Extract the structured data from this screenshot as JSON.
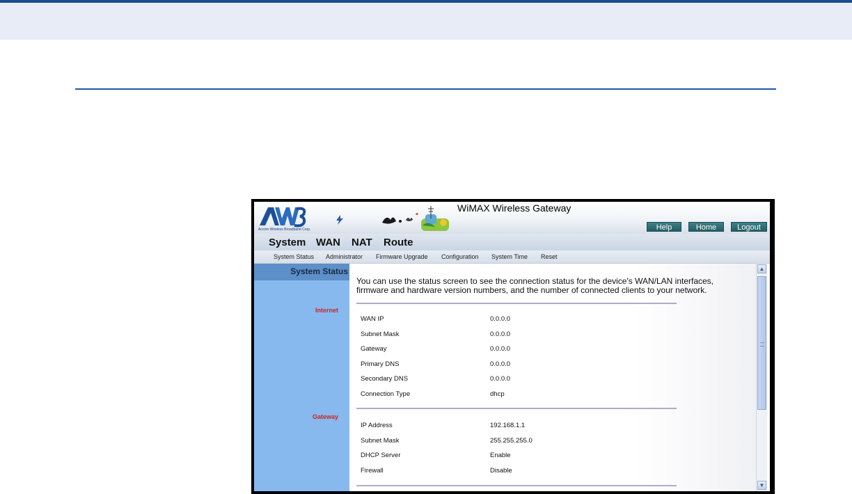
{
  "header": {
    "logo_text": "AW3",
    "logo_subtitle": "Accton Wireless Broadband Corp.",
    "title": "WiMAX Wireless Gateway",
    "buttons": [
      {
        "label": "Help"
      },
      {
        "label": "Home"
      },
      {
        "label": "Logout"
      }
    ]
  },
  "menu": {
    "items": [
      "System",
      "WAN",
      "NAT",
      "Route"
    ]
  },
  "submenu": {
    "items": [
      "System Status",
      "Administrator",
      "Firmware Upgrade",
      "Configuration",
      "System Time",
      "Reset"
    ]
  },
  "sidebar": {
    "heading": "System Status",
    "sections": [
      "Internet",
      "Gateway"
    ]
  },
  "content": {
    "intro": "You can use the status screen to see the connection status for the device's WAN/LAN interfaces, firmware and hardware version numbers, and the number of connected clients to your network.",
    "internet_rows": [
      {
        "label": "WAN IP",
        "value": "0.0.0.0"
      },
      {
        "label": "Subnet Mask",
        "value": "0.0.0.0"
      },
      {
        "label": "Gateway",
        "value": "0.0.0.0"
      },
      {
        "label": "Primary DNS",
        "value": "0.0.0.0"
      },
      {
        "label": "Secondary DNS",
        "value": "0.0.0.0"
      },
      {
        "label": "Connection Type",
        "value": "dhcp"
      }
    ],
    "gateway_rows": [
      {
        "label": "IP Address",
        "value": "192.168.1.1"
      },
      {
        "label": "Subnet Mask",
        "value": "255.255.255.0"
      },
      {
        "label": "DHCP Server",
        "value": "Enable"
      },
      {
        "label": "Firewall",
        "value": "Disable"
      }
    ]
  },
  "colors": {
    "accent": "#1d5aa3",
    "sidebar": "#87b9ee",
    "section_label": "#d2231e",
    "button": "#2d6c73"
  }
}
